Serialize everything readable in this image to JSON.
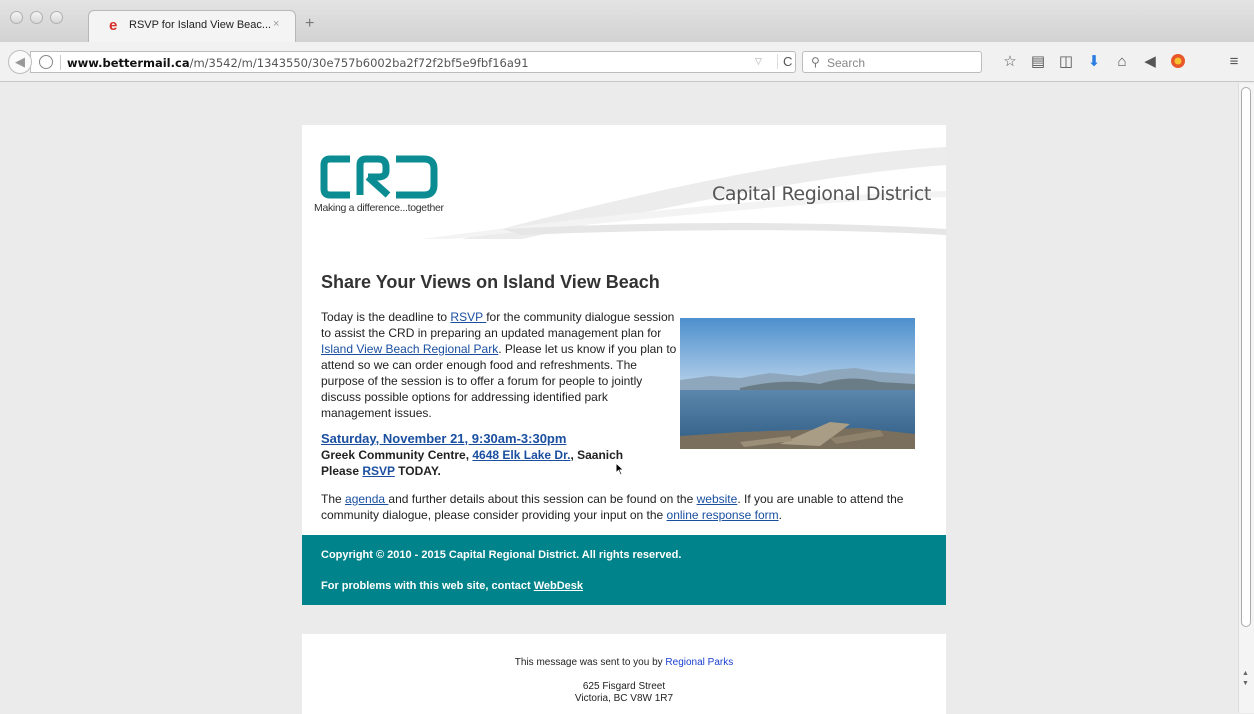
{
  "browser": {
    "tab_title": "RSVP for Island View Beac...",
    "tab_close": "×",
    "new_tab": "+",
    "url_domain": "www.bettermail.ca",
    "url_path": "/m/3542/m/1343550/30e757b6002ba2f72f2bf5e9fbf16a91",
    "search_placeholder": "Search"
  },
  "header": {
    "tagline": "Making a difference...together",
    "district": "Capital Regional District",
    "brand_color": "#00838a"
  },
  "content": {
    "title": "Share Your Views on Island View Beach",
    "intro_1": "Today is the deadline to ",
    "rsvp_link": "RSVP ",
    "intro_2": "for the community dialogue session to assist the CRD in preparing an updated management plan for ",
    "park_link": "Island View Beach Regional Park",
    "intro_3": ". Please let us know if you plan to attend so we can order enough food and refreshments. The purpose of the session is to offer a forum for people to jointly discuss possible options for addressing identified park management issues.",
    "event_date": "Saturday, November 21, 9:30am-3:30pm",
    "venue_1": "Greek Community Centre, ",
    "venue_link": "4648 Elk Lake Dr.",
    "venue_2": ", Saanich",
    "please": "Please ",
    "rsvp_link_2": "RSVP",
    "today": " TODAY.",
    "details_1": "The ",
    "agenda_link": "agenda ",
    "details_2": "and further details about this session can be found on the ",
    "website_link": "website",
    "details_3": ". If you are unable to attend the community dialogue, please consider providing your input on the ",
    "response_link": "online response form",
    "details_4": "."
  },
  "footer": {
    "copyright": "Copyright © 2010 - 2015 Capital Regional District. All rights reserved.",
    "problems": "For problems with this web site, contact ",
    "webdesk_link": "WebDesk"
  },
  "sender": {
    "sent_by": "This message was sent to you by ",
    "sender_link": "Regional Parks",
    "address_1": "625 Fisgard Street",
    "address_2": "Victoria, BC V8W 1R7"
  }
}
